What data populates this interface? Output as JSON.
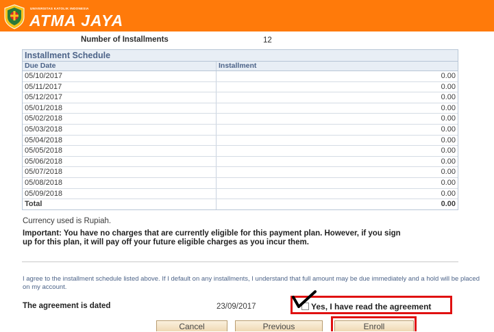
{
  "branding": {
    "university_small": "UNIVERSITAS KATOLIK INDONESIA",
    "university_name": "ATMA JAYA",
    "banner_color": "#ff7a0a"
  },
  "plan": {
    "installments_label": "Number of Installments",
    "installments_value": "12"
  },
  "schedule": {
    "title": "Installment Schedule",
    "columns": [
      "Due Date",
      "Installment"
    ],
    "rows": [
      {
        "due_date": "05/10/2017",
        "amount": "0.00"
      },
      {
        "due_date": "05/11/2017",
        "amount": "0.00"
      },
      {
        "due_date": "05/12/2017",
        "amount": "0.00"
      },
      {
        "due_date": "05/01/2018",
        "amount": "0.00"
      },
      {
        "due_date": "05/02/2018",
        "amount": "0.00"
      },
      {
        "due_date": "05/03/2018",
        "amount": "0.00"
      },
      {
        "due_date": "05/04/2018",
        "amount": "0.00"
      },
      {
        "due_date": "05/05/2018",
        "amount": "0.00"
      },
      {
        "due_date": "05/06/2018",
        "amount": "0.00"
      },
      {
        "due_date": "05/07/2018",
        "amount": "0.00"
      },
      {
        "due_date": "05/08/2018",
        "amount": "0.00"
      },
      {
        "due_date": "05/09/2018",
        "amount": "0.00"
      }
    ],
    "total_label": "Total",
    "total_value": "0.00"
  },
  "notes": {
    "currency": "Currency used is Rupiah.",
    "important": "Important:  You have no charges that are currently eligible for this payment plan. However, if you sign up for this plan, it will pay off your future eligible charges as you incur them."
  },
  "agreement": {
    "text": "I agree to the installment schedule listed above.  If I default on any installments, I understand that full amount may be due immediately and a hold will be placed on my account.",
    "dated_label": "The agreement is dated",
    "dated_value": "23/09/2017",
    "checkbox_label": "Yes, I have read the agreement",
    "checked": false
  },
  "buttons": {
    "cancel": "Cancel",
    "previous": "Previous",
    "enroll": "Enroll"
  },
  "annotation_color": "#e01010"
}
